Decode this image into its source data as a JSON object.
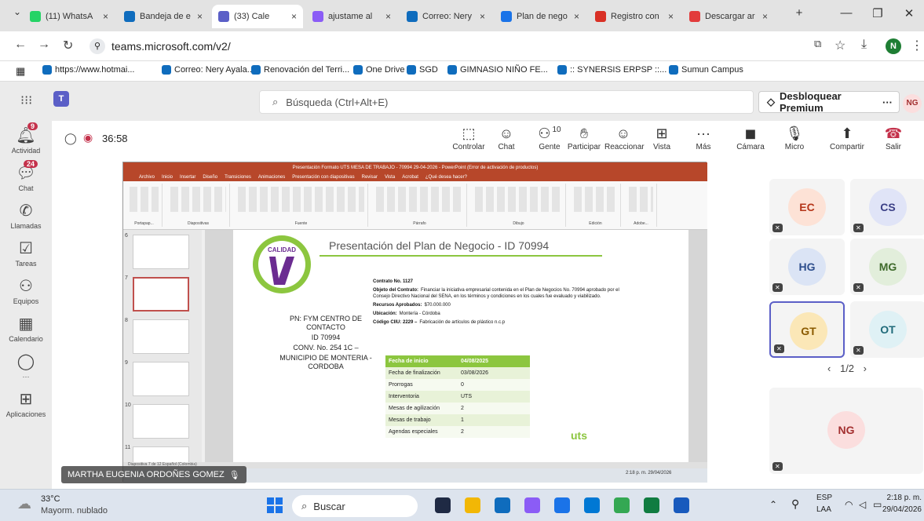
{
  "browser": {
    "tabs": [
      {
        "label": "(11) WhatsA",
        "badge": "11",
        "color": "#25d366"
      },
      {
        "label": "Bandeja de e",
        "color": "#0f6cbd"
      },
      {
        "label": "(33) Cale",
        "color": "#5b5fc7"
      },
      {
        "label": "ajustame al",
        "color": "#8b5cf6"
      },
      {
        "label": "Correo: Nery",
        "color": "#0f6cbd"
      },
      {
        "label": "Plan de nego",
        "color": "#1a73e8"
      },
      {
        "label": "Registro con",
        "color": "#d93025"
      },
      {
        "label": "Descargar ar",
        "color": "#e23c3c"
      }
    ],
    "close_glyph": "×",
    "new_tab": "+",
    "url": "teams.microsoft.com/v2/",
    "bookmarks": [
      "https://www.hotmai...",
      "Correo: Nery Ayala...",
      "Renovación del Terri...",
      "One Drive",
      "SGD",
      "GIMNASIO NIÑO FE...",
      ":: SYNERSIS ERPSP ::...",
      "Sumun Campus"
    ],
    "profile_initial": "N"
  },
  "teams": {
    "search_placeholder": "Búsqueda (Ctrl+Alt+E)",
    "premium_label": "Desbloquear Premium",
    "more": "···",
    "user_initials": "NG",
    "rail": [
      {
        "label": "Actividad",
        "badge": "9",
        "icon": "bell-icon"
      },
      {
        "label": "Chat",
        "badge": "24",
        "icon": "chat-icon"
      },
      {
        "label": "Llamadas",
        "badge": "",
        "icon": "phone-icon"
      },
      {
        "label": "Tareas",
        "badge": "",
        "icon": "tasks-icon"
      },
      {
        "label": "Equipos",
        "badge": "",
        "icon": "teams-icon"
      },
      {
        "label": "Calendario",
        "badge": "",
        "icon": "calendar-icon"
      },
      {
        "label": "···",
        "badge": "",
        "icon": "more-icon"
      },
      {
        "label": "Aplicaciones",
        "badge": "",
        "icon": "apps-icon"
      }
    ],
    "timer": "36:58",
    "controls": [
      {
        "label": "Controlar",
        "icon": "control-icon"
      },
      {
        "label": "Chat",
        "icon": "chat-icon"
      },
      {
        "label": "Gente",
        "icon": "people-icon",
        "count": "10"
      },
      {
        "label": "Participar",
        "icon": "raise-hand-icon"
      },
      {
        "label": "Reaccionar",
        "icon": "react-icon"
      },
      {
        "label": "Vista",
        "icon": "view-icon"
      },
      {
        "label": "Más",
        "icon": "more-icon"
      },
      {
        "label": "Cámara",
        "icon": "camera-off-icon"
      },
      {
        "label": "Micro",
        "icon": "mic-off-icon"
      },
      {
        "label": "Compartir",
        "icon": "share-icon"
      },
      {
        "label": "Salir",
        "icon": "leave-icon"
      }
    ],
    "participants": [
      {
        "initials": "EC",
        "bg": "#fde2d6",
        "fg": "#b5361a"
      },
      {
        "initials": "CS",
        "bg": "#e0e4f7",
        "fg": "#3b3f86"
      },
      {
        "initials": "HG",
        "bg": "#dbe4f5",
        "fg": "#2e4e8c"
      },
      {
        "initials": "MG",
        "bg": "#e2eedb",
        "fg": "#3f6a2b"
      },
      {
        "initials": "GT",
        "bg": "#fbe7b7",
        "fg": "#8a5a00"
      },
      {
        "initials": "OT",
        "bg": "#dff1f5",
        "fg": "#216b7a"
      },
      {
        "initials": "NG",
        "bg": "#fbdede",
        "fg": "#a33030"
      }
    ],
    "pager": "1/2",
    "speaker": "MARTHA EUGENIA ORDOÑES GOMEZ"
  },
  "ppt": {
    "window_title": "Presentación Formato UTS MESA DE TRABAJO - 70994 29-04-2026 - PowerPoint (Error de activación de productos)",
    "menu": [
      "Archivo",
      "Inicio",
      "Insertar",
      "Diseño",
      "Transiciones",
      "Animaciones",
      "Presentación con diapositivas",
      "Revisar",
      "Vista",
      "Acrobat",
      "¿Qué desea hacer?"
    ],
    "ribbon_groups": [
      "Portapap...",
      "Diapositivas",
      "Fuente",
      "Párrafo",
      "Dibujo",
      "Edición",
      "Adobe..."
    ],
    "thumb_numbers": [
      "6",
      "7",
      "8",
      "9",
      "10",
      "11"
    ],
    "slide_title": "Presentación del Plan de Negocio - ID 70994",
    "logo_text": "CALIDAD",
    "left_block": [
      "PN: FYM CENTRO DE CONTACTO",
      "ID 70994",
      "CONV. No. 254 1C –",
      "MUNICIPIO DE MONTERIA - CORDOBA"
    ],
    "contract": [
      {
        "k": "Contrato No. 1127",
        "v": ""
      },
      {
        "k": "Objeto del Contrato:",
        "v": "Financiar la iniciativa empresarial contenida en el Plan de Negocios No. 70994 aprobado por el Consejo Directivo Nacional del SENA, en los términos y condiciones en los cuales fue evaluado y viabilizado."
      },
      {
        "k": "Recursos Aprobados:",
        "v": "$70.000.000"
      },
      {
        "k": "Ubicación:",
        "v": "Montería - Córdoba"
      },
      {
        "k": "Código CIIU: 2229 –",
        "v": "Fabricación de artículos de plástico n.c.p"
      }
    ],
    "table": [
      [
        "Fecha de inicio",
        "04/08/2025"
      ],
      [
        "Fecha de finalización",
        "03/08/2026"
      ],
      [
        "Prorrogas",
        "0"
      ],
      [
        "Interventoria",
        "UTS"
      ],
      [
        "Mesas de agilización",
        "2"
      ],
      [
        "Mesas de trabajo",
        "1"
      ],
      [
        "Agendas especiales",
        "2"
      ]
    ],
    "uts_logo": "uts",
    "status": "Diapositiva 7 de 12   Español (Colombia)",
    "inner_clock": "2:18 p. m. 29/04/2026"
  },
  "taskbar": {
    "weather_temp": "33°C",
    "weather_desc": "Mayorm. nublado",
    "search": "Buscar",
    "lang": "ESP",
    "lang2": "LAA",
    "time": "2:18 p. m.",
    "date": "29/04/2026"
  }
}
